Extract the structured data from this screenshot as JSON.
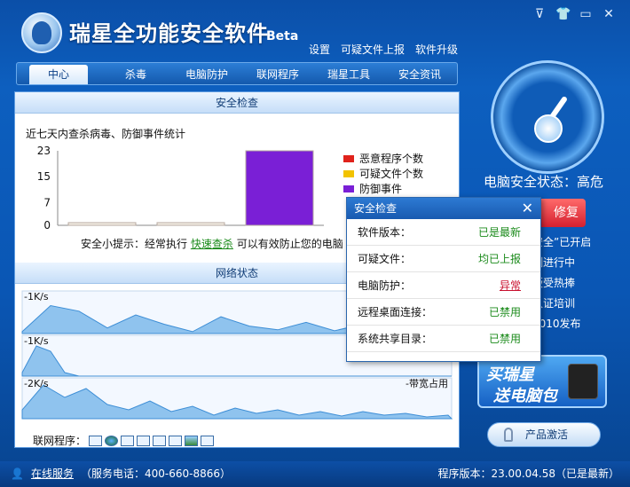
{
  "header": {
    "title": "瑞星全功能安全软件",
    "beta": "Beta",
    "links": [
      "设置",
      "可疑文件上报",
      "软件升级"
    ]
  },
  "nav": {
    "tabs": [
      "中心",
      "杀毒",
      "电脑防护",
      "联网程序",
      "瑞星工具",
      "安全资讯"
    ],
    "active": "中心"
  },
  "security_section": {
    "title": "安全检查",
    "stats_title": "近七天内查杀病毒、防御事件统计",
    "legend": [
      {
        "label": "恶意程序个数",
        "color": "#e0221b"
      },
      {
        "label": "可疑文件个数",
        "color": "#f2c300"
      },
      {
        "label": "防御事件",
        "color": "#7a1fd6"
      }
    ],
    "tip_prefix": "安全小提示：经常执行",
    "tip_link": "快速查杀",
    "tip_suffix": "可以有效防止您的电脑"
  },
  "chart_data": {
    "type": "bar",
    "categories": [
      "恶意程序个数",
      "可疑文件个数",
      "防御事件"
    ],
    "values": [
      0,
      0,
      23
    ],
    "ylim": [
      0,
      23
    ],
    "yticks": [
      "23",
      "15",
      "7",
      "0"
    ],
    "colors": [
      "#e0221b",
      "#f2c300",
      "#7a1fd6"
    ]
  },
  "network_section": {
    "title": "网络状态",
    "graphs": [
      {
        "label": "-1K/s",
        "right_label": ""
      },
      {
        "label": "-1K/s",
        "right_label": ""
      },
      {
        "label": "-2K/s",
        "right_label": "-带宽占用"
      }
    ],
    "programs_label": "联网程序："
  },
  "right_panel": {
    "status": "电脑安全状态：高危",
    "repair_label": "修复",
    "side_items": [
      "安全”已开启",
      "测进行中",
      "版受热捧",
      "认证培训",
      "2010发布"
    ],
    "ad_line1": "买瑞星",
    "ad_line2": "送电脑包",
    "activate_label": "产品激活"
  },
  "popup": {
    "title": "安全检查",
    "rows": [
      {
        "label": "软件版本：",
        "value": "已是最新",
        "state": "ok"
      },
      {
        "label": "可疑文件：",
        "value": "均已上报",
        "state": "ok"
      },
      {
        "label": "电脑防护：",
        "value": "异常",
        "state": "bad"
      },
      {
        "label": "远程桌面连接：",
        "value": "已禁用",
        "state": "ok"
      },
      {
        "label": "系统共享目录：",
        "value": "已禁用",
        "state": "ok"
      }
    ]
  },
  "footer": {
    "online": "在线服务",
    "phone": "（服务电话：400-660-8866）",
    "version": "程序版本：23.00.04.58（已是最新）"
  }
}
